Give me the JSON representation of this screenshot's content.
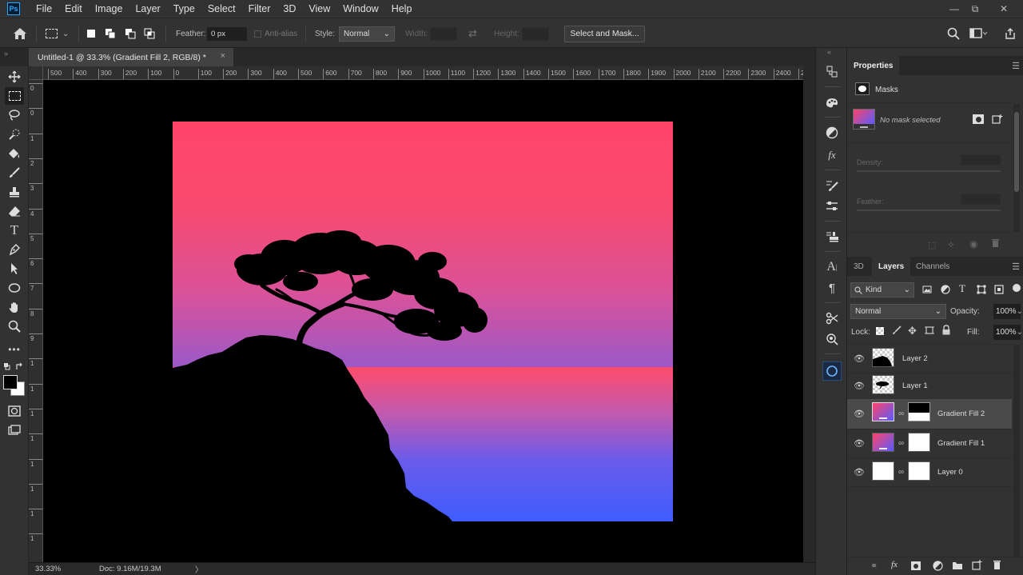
{
  "app": {
    "logo": "Ps"
  },
  "menu": [
    "File",
    "Edit",
    "Image",
    "Layer",
    "Type",
    "Select",
    "Filter",
    "3D",
    "View",
    "Window",
    "Help"
  ],
  "options_bar": {
    "feather_label": "Feather:",
    "feather_value": "0 px",
    "anti_alias_label": "Anti-alias",
    "style_label": "Style:",
    "style_value": "Normal",
    "width_label": "Width:",
    "height_label": "Height:",
    "select_mask_label": "Select and Mask..."
  },
  "document": {
    "tab_title": "Untitled-1 @ 33.3% (Gradient Fill 2, RGB/8) *",
    "close_glyph": "×"
  },
  "ruler_h": [
    "500",
    "400",
    "300",
    "200",
    "100",
    "0",
    "100",
    "200",
    "300",
    "400",
    "500",
    "600",
    "700",
    "800",
    "900",
    "1000",
    "1100",
    "1200",
    "1300",
    "1400",
    "1500",
    "1600",
    "1700",
    "1800",
    "1900",
    "2000",
    "2100",
    "2200",
    "2300",
    "2400",
    "2"
  ],
  "ruler_v": [
    "0",
    "0",
    "1",
    "2",
    "3",
    "4",
    "5",
    "6",
    "7",
    "8",
    "9",
    "1",
    "1",
    "1",
    "1",
    "1",
    "1",
    "1",
    "1"
  ],
  "status": {
    "zoom": "33.33%",
    "doc": "Doc: 9.16M/19.3M",
    "arrow": "〉"
  },
  "properties": {
    "title": "Properties",
    "masks_label": "Masks",
    "no_mask": "No mask selected",
    "density_label": "Density:",
    "feather_label": "Feather:"
  },
  "layers_panel": {
    "tabs": [
      "3D",
      "Layers",
      "Channels"
    ],
    "active_tab": "Layers",
    "filter_kind": "Kind",
    "blend_mode": "Normal",
    "opacity_label": "Opacity:",
    "opacity_value": "100%",
    "lock_label": "Lock:",
    "fill_label": "Fill:",
    "fill_value": "100%",
    "layers": [
      {
        "name": "Layer 2",
        "thumb": "checker-silhouette",
        "mask": false,
        "selected": false
      },
      {
        "name": "Layer 1",
        "thumb": "checker-tree",
        "mask": false,
        "selected": false
      },
      {
        "name": "Gradient Fill 2",
        "thumb": "gradient",
        "mask": "black-white",
        "selected": true
      },
      {
        "name": "Gradient Fill 1",
        "thumb": "gradient",
        "mask": "white",
        "selected": false
      },
      {
        "name": "Layer 0",
        "thumb": "white",
        "mask": "white",
        "selected": false
      }
    ]
  },
  "colors": {
    "sky_top": "#ff4468",
    "sky_horizon": "#9b58c8",
    "sea_top": "#e8527a",
    "sea_bottom": "#3f5cff",
    "accent": "#31a8ff"
  }
}
